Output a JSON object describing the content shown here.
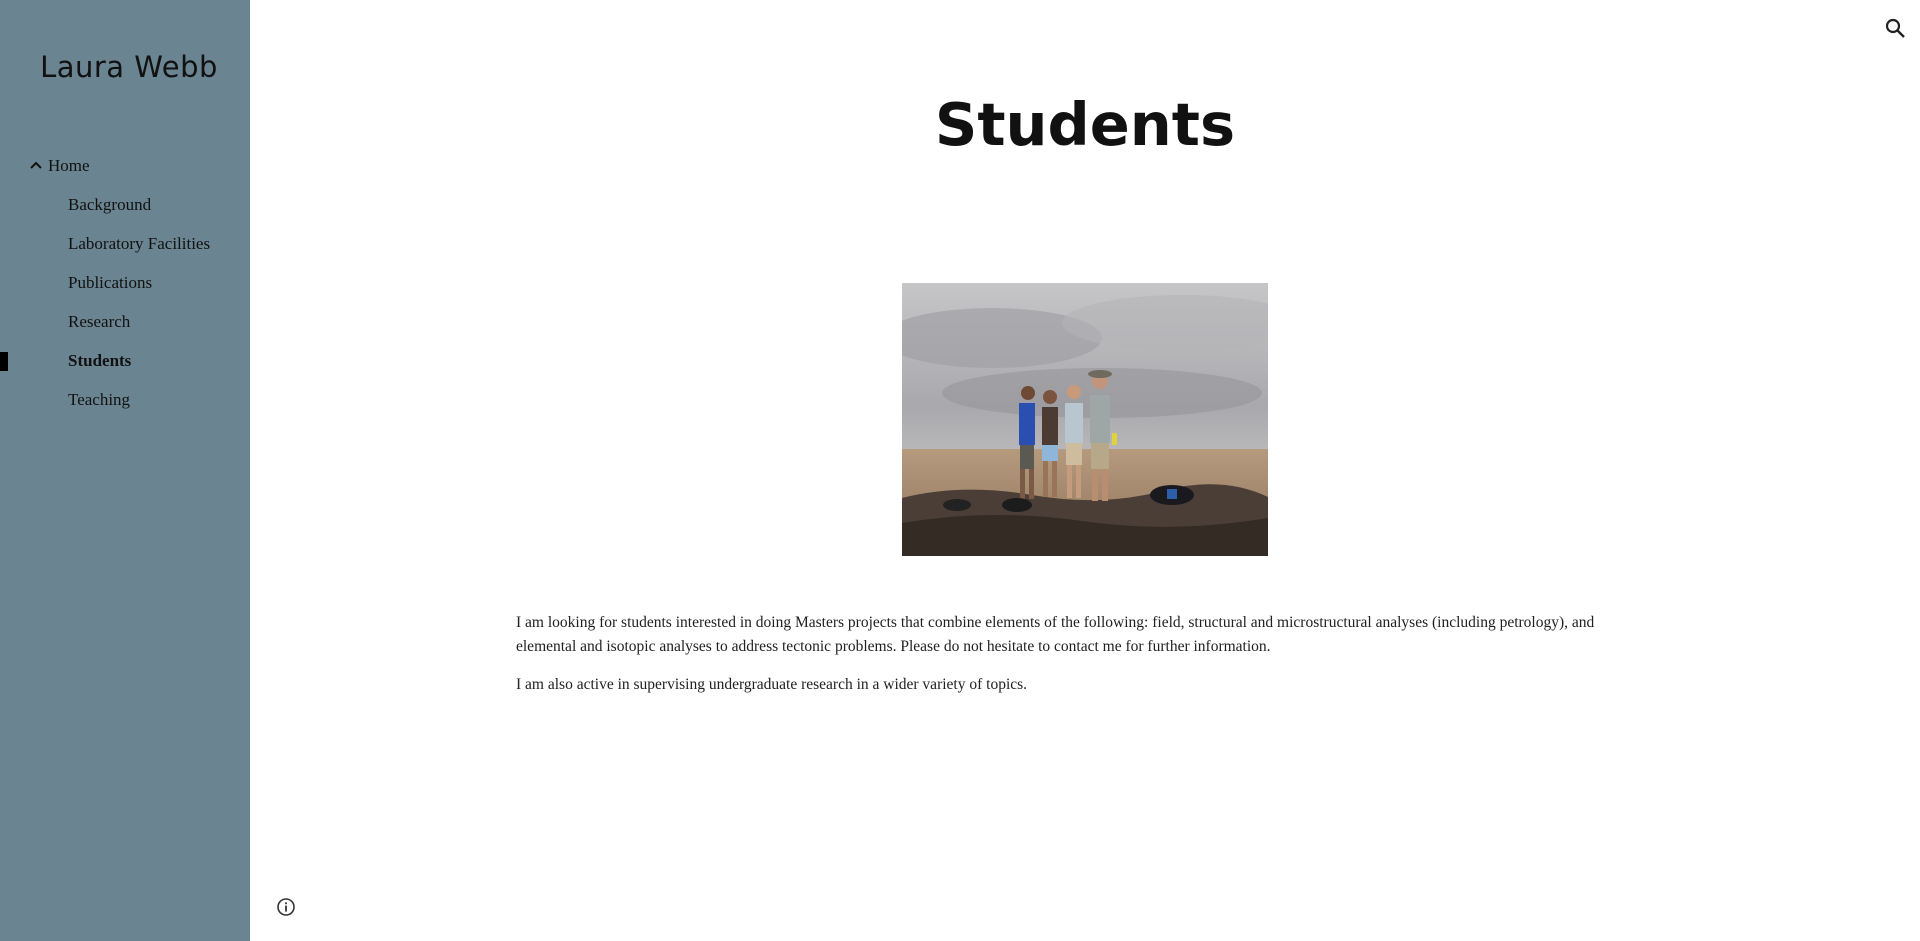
{
  "sidebar": {
    "site_title": "Laura Webb",
    "bg_color": "#6a8591",
    "items": [
      {
        "label": "Home",
        "icon": "chevron-up-icon",
        "expanded": true
      },
      {
        "label": "Background"
      },
      {
        "label": "Laboratory Facilities"
      },
      {
        "label": "Publications"
      },
      {
        "label": "Research"
      },
      {
        "label": "Students",
        "active": true
      },
      {
        "label": "Teaching"
      }
    ]
  },
  "header": {
    "search_icon": "search-icon"
  },
  "main": {
    "title": "Students",
    "image": {
      "description_icon": "group-photo"
    },
    "paragraphs": [
      "I am looking for students interested in doing Masters projects that combine elements of the following: field, structural and microstructural analyses (including petrology), and elemental and isotopic analyses to address tectonic problems. Please do not hesitate to contact me for further information.",
      "I am also active in supervising undergraduate research in a wider variety of topics."
    ]
  },
  "footer": {
    "info_icon": "info-icon"
  }
}
